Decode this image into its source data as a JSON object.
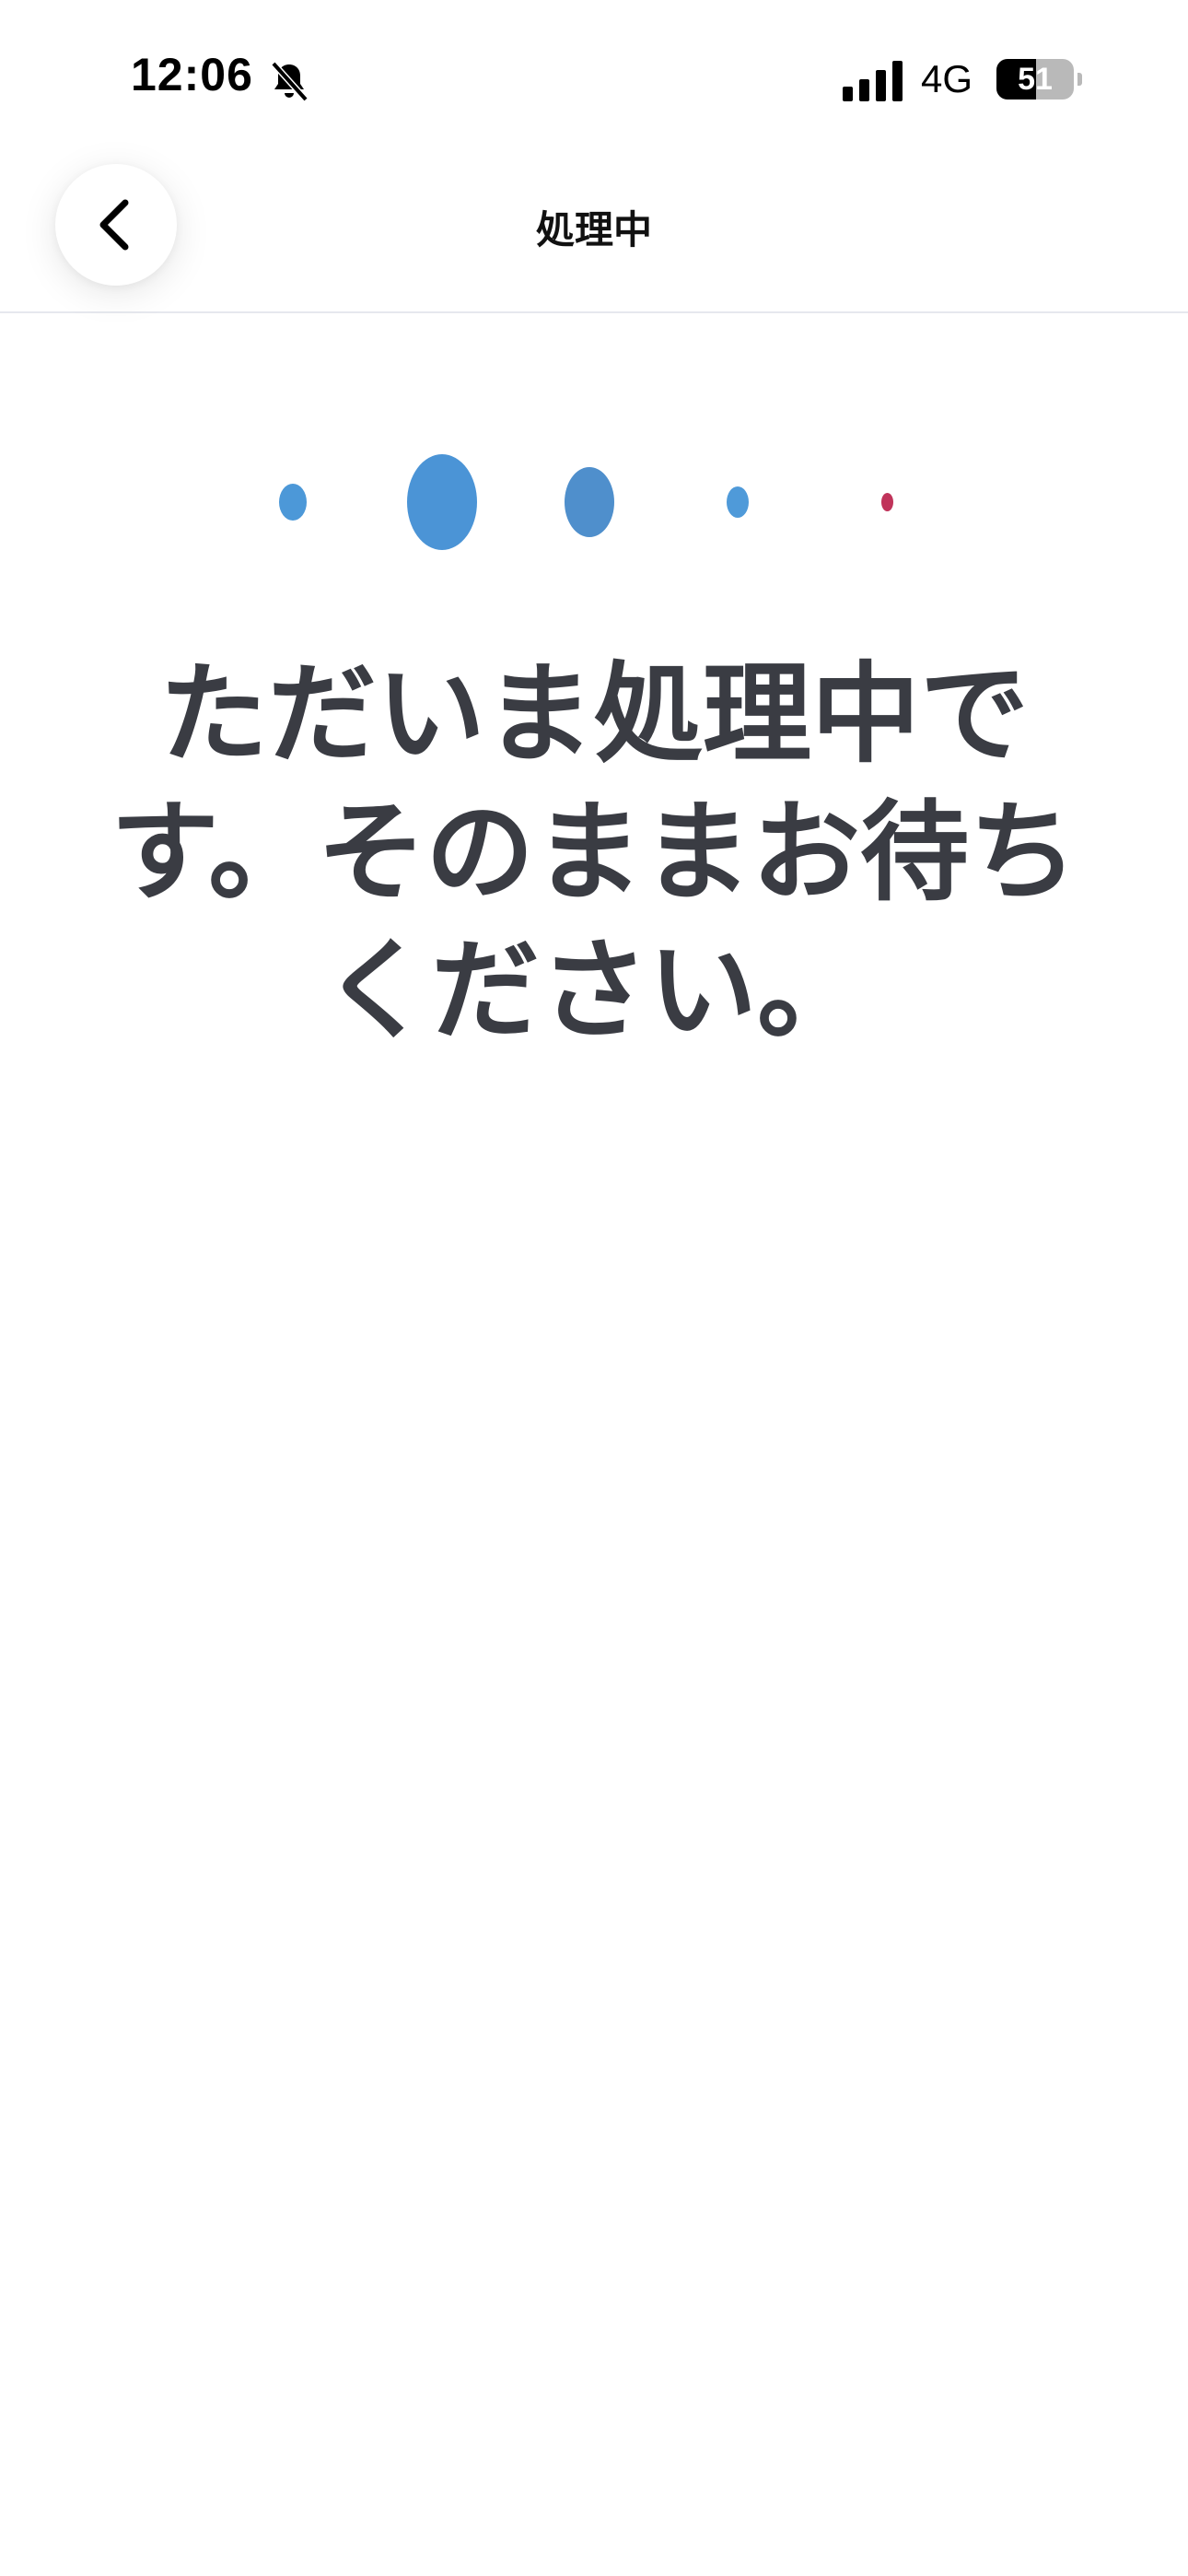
{
  "status_bar": {
    "time": "12:06",
    "network": "4G",
    "battery_percent": "51",
    "battery_level": 0.51,
    "icons": [
      "bell-muted-icon",
      "cellular-signal-icon",
      "battery-icon"
    ]
  },
  "header": {
    "back_icon": "chevron-left-icon",
    "title": "処理中"
  },
  "loader": {
    "colors": [
      "#4c98d8",
      "#4b94d6",
      "#4f8fcc",
      "#4f9ad9",
      "#c0335a"
    ]
  },
  "main": {
    "message": "ただいま処理中です。そのままお待ちください。"
  }
}
